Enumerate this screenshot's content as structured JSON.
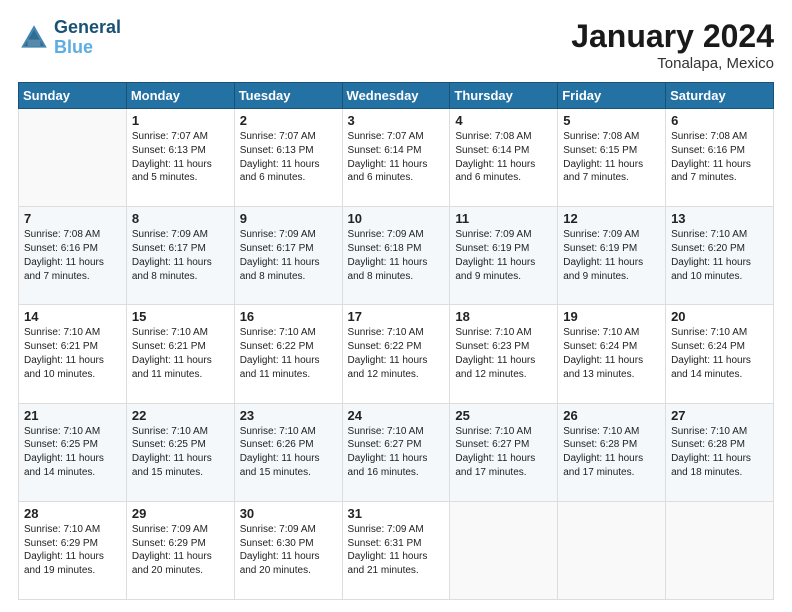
{
  "header": {
    "logo_line1": "General",
    "logo_line2": "Blue",
    "month": "January 2024",
    "location": "Tonalapa, Mexico"
  },
  "weekdays": [
    "Sunday",
    "Monday",
    "Tuesday",
    "Wednesday",
    "Thursday",
    "Friday",
    "Saturday"
  ],
  "weeks": [
    [
      {
        "day": "",
        "info": ""
      },
      {
        "day": "1",
        "info": "Sunrise: 7:07 AM\nSunset: 6:13 PM\nDaylight: 11 hours\nand 5 minutes."
      },
      {
        "day": "2",
        "info": "Sunrise: 7:07 AM\nSunset: 6:13 PM\nDaylight: 11 hours\nand 6 minutes."
      },
      {
        "day": "3",
        "info": "Sunrise: 7:07 AM\nSunset: 6:14 PM\nDaylight: 11 hours\nand 6 minutes."
      },
      {
        "day": "4",
        "info": "Sunrise: 7:08 AM\nSunset: 6:14 PM\nDaylight: 11 hours\nand 6 minutes."
      },
      {
        "day": "5",
        "info": "Sunrise: 7:08 AM\nSunset: 6:15 PM\nDaylight: 11 hours\nand 7 minutes."
      },
      {
        "day": "6",
        "info": "Sunrise: 7:08 AM\nSunset: 6:16 PM\nDaylight: 11 hours\nand 7 minutes."
      }
    ],
    [
      {
        "day": "7",
        "info": "Sunrise: 7:08 AM\nSunset: 6:16 PM\nDaylight: 11 hours\nand 7 minutes."
      },
      {
        "day": "8",
        "info": "Sunrise: 7:09 AM\nSunset: 6:17 PM\nDaylight: 11 hours\nand 8 minutes."
      },
      {
        "day": "9",
        "info": "Sunrise: 7:09 AM\nSunset: 6:17 PM\nDaylight: 11 hours\nand 8 minutes."
      },
      {
        "day": "10",
        "info": "Sunrise: 7:09 AM\nSunset: 6:18 PM\nDaylight: 11 hours\nand 8 minutes."
      },
      {
        "day": "11",
        "info": "Sunrise: 7:09 AM\nSunset: 6:19 PM\nDaylight: 11 hours\nand 9 minutes."
      },
      {
        "day": "12",
        "info": "Sunrise: 7:09 AM\nSunset: 6:19 PM\nDaylight: 11 hours\nand 9 minutes."
      },
      {
        "day": "13",
        "info": "Sunrise: 7:10 AM\nSunset: 6:20 PM\nDaylight: 11 hours\nand 10 minutes."
      }
    ],
    [
      {
        "day": "14",
        "info": "Sunrise: 7:10 AM\nSunset: 6:21 PM\nDaylight: 11 hours\nand 10 minutes."
      },
      {
        "day": "15",
        "info": "Sunrise: 7:10 AM\nSunset: 6:21 PM\nDaylight: 11 hours\nand 11 minutes."
      },
      {
        "day": "16",
        "info": "Sunrise: 7:10 AM\nSunset: 6:22 PM\nDaylight: 11 hours\nand 11 minutes."
      },
      {
        "day": "17",
        "info": "Sunrise: 7:10 AM\nSunset: 6:22 PM\nDaylight: 11 hours\nand 12 minutes."
      },
      {
        "day": "18",
        "info": "Sunrise: 7:10 AM\nSunset: 6:23 PM\nDaylight: 11 hours\nand 12 minutes."
      },
      {
        "day": "19",
        "info": "Sunrise: 7:10 AM\nSunset: 6:24 PM\nDaylight: 11 hours\nand 13 minutes."
      },
      {
        "day": "20",
        "info": "Sunrise: 7:10 AM\nSunset: 6:24 PM\nDaylight: 11 hours\nand 14 minutes."
      }
    ],
    [
      {
        "day": "21",
        "info": "Sunrise: 7:10 AM\nSunset: 6:25 PM\nDaylight: 11 hours\nand 14 minutes."
      },
      {
        "day": "22",
        "info": "Sunrise: 7:10 AM\nSunset: 6:25 PM\nDaylight: 11 hours\nand 15 minutes."
      },
      {
        "day": "23",
        "info": "Sunrise: 7:10 AM\nSunset: 6:26 PM\nDaylight: 11 hours\nand 15 minutes."
      },
      {
        "day": "24",
        "info": "Sunrise: 7:10 AM\nSunset: 6:27 PM\nDaylight: 11 hours\nand 16 minutes."
      },
      {
        "day": "25",
        "info": "Sunrise: 7:10 AM\nSunset: 6:27 PM\nDaylight: 11 hours\nand 17 minutes."
      },
      {
        "day": "26",
        "info": "Sunrise: 7:10 AM\nSunset: 6:28 PM\nDaylight: 11 hours\nand 17 minutes."
      },
      {
        "day": "27",
        "info": "Sunrise: 7:10 AM\nSunset: 6:28 PM\nDaylight: 11 hours\nand 18 minutes."
      }
    ],
    [
      {
        "day": "28",
        "info": "Sunrise: 7:10 AM\nSunset: 6:29 PM\nDaylight: 11 hours\nand 19 minutes."
      },
      {
        "day": "29",
        "info": "Sunrise: 7:09 AM\nSunset: 6:29 PM\nDaylight: 11 hours\nand 20 minutes."
      },
      {
        "day": "30",
        "info": "Sunrise: 7:09 AM\nSunset: 6:30 PM\nDaylight: 11 hours\nand 20 minutes."
      },
      {
        "day": "31",
        "info": "Sunrise: 7:09 AM\nSunset: 6:31 PM\nDaylight: 11 hours\nand 21 minutes."
      },
      {
        "day": "",
        "info": ""
      },
      {
        "day": "",
        "info": ""
      },
      {
        "day": "",
        "info": ""
      }
    ]
  ]
}
